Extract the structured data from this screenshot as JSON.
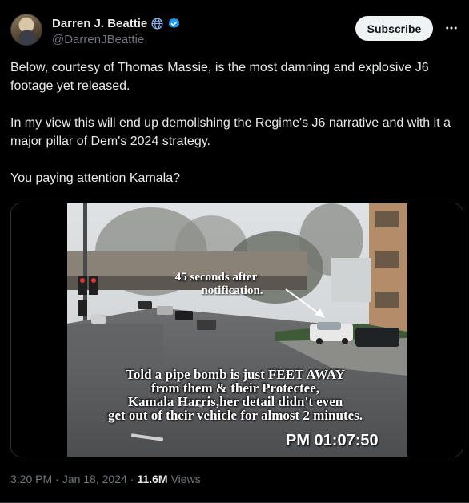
{
  "author": {
    "display_name": "Darren J. Beattie",
    "handle": "@DarrenJBeattie",
    "verified_color": "#1d9bf0"
  },
  "header": {
    "subscribe_label": "Subscribe",
    "more_icon": "more-dots-icon"
  },
  "tweet": {
    "paragraphs": [
      "Below, courtesy of Thomas Massie, is the most damning and explosive J6 footage yet released.",
      "In my view this will end up demolishing the Regime's J6 narrative and with it a major pillar of Dem's 2024 strategy.",
      "You paying attention Kamala?"
    ]
  },
  "video": {
    "caption_top_line1": "45 seconds after",
    "caption_top_line2": "notification.",
    "caption_bottom_line1": "Told a pipe bomb is just FEET AWAY",
    "caption_bottom_line2": "from them & their Protectee,",
    "caption_bottom_line3": "Kamala Harris,her detail didn't even",
    "caption_bottom_line4": "get out of their vehicle for almost 2 minutes.",
    "timestamp": "PM 01:07:50"
  },
  "meta": {
    "time": "3:20 PM",
    "separator": "·",
    "date": "Jan 18, 2024",
    "views_count": "11.6M",
    "views_label": "Views"
  }
}
